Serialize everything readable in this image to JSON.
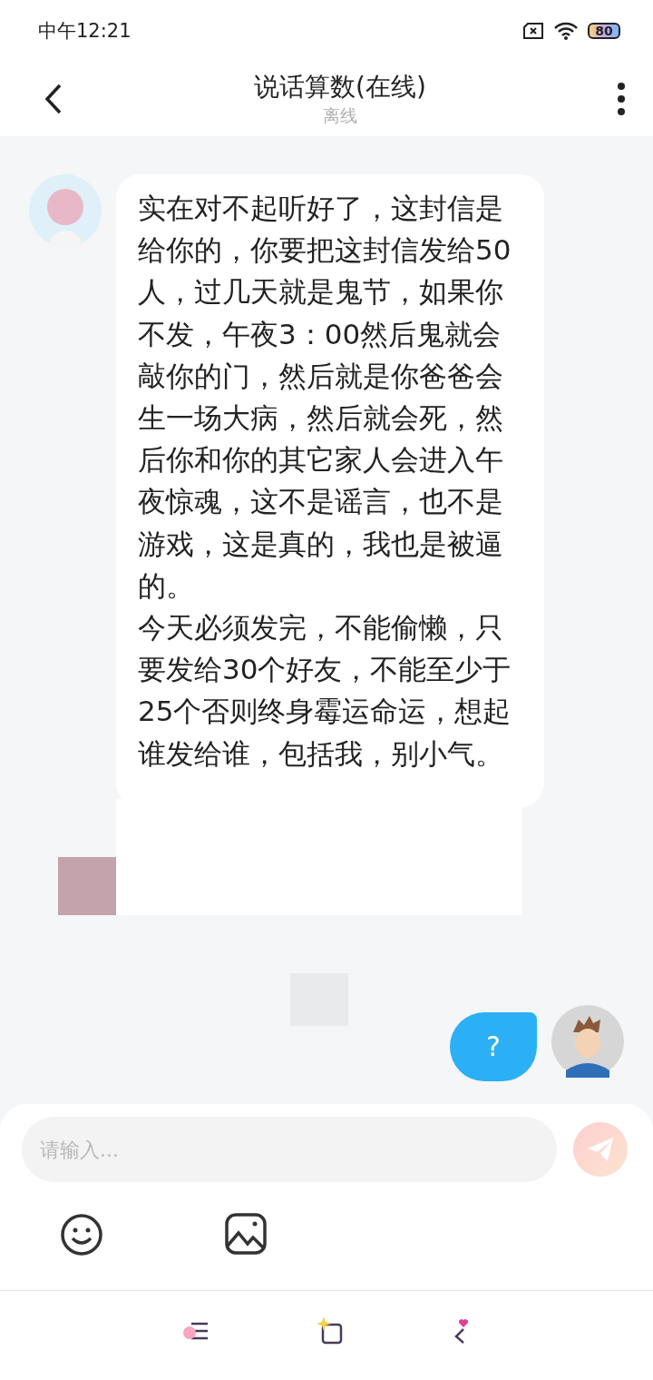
{
  "status_bar": {
    "time": "中午12:21",
    "battery": "80"
  },
  "header": {
    "title": "说话算数(在线)",
    "subtitle": "离线"
  },
  "messages": [
    {
      "kind": "text",
      "paragraphs": [
        "实在对不起听好了，这封信是给你的，你要把这封信发给50人，过几天就是鬼节，如果你不发，午夜3：00然后鬼就会敲你的门，然后就是你爸爸会生一场大病，然后就会死，然后你和你的其它家人会进入午夜惊魂，这不是谣言，也不是游戏，这是真的，我也是被逼的。",
        "今天必须发完，不能偷懒，只要发给30个好友，不能至少于25个否则终身霉运命运，想起谁发给谁，包括我，别小气。"
      ]
    },
    {
      "kind": "question",
      "text": "?"
    }
  ],
  "composer": {
    "placeholder": "请输入..."
  }
}
